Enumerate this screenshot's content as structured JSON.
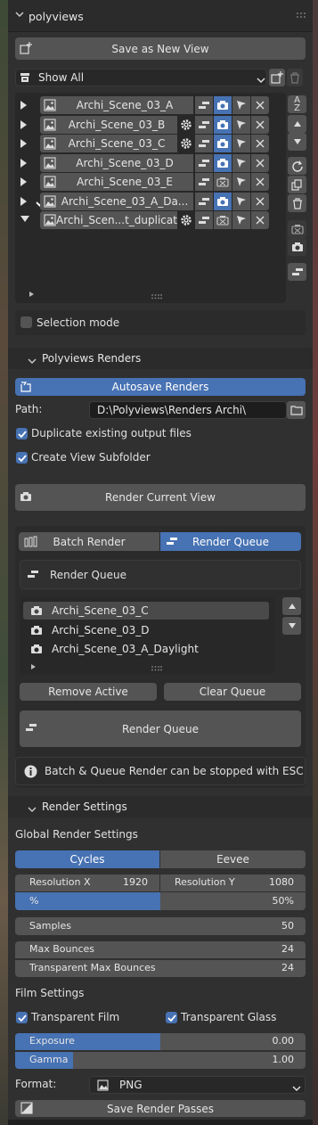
{
  "panel": {
    "title": "polyviews"
  },
  "save_view": {
    "label": "Save as New View"
  },
  "filter": {
    "value": "Show All"
  },
  "views": [
    {
      "name": "Archi_Scene_03_A",
      "gear": false,
      "check": false,
      "expanded": false,
      "render_on": true
    },
    {
      "name": "Archi_Scene_03_B",
      "gear": true,
      "check": false,
      "expanded": false,
      "render_on": true
    },
    {
      "name": "Archi_Scene_03_C",
      "gear": true,
      "check": false,
      "expanded": false,
      "render_on": true
    },
    {
      "name": "Archi_Scene_03_D",
      "gear": false,
      "check": false,
      "expanded": false,
      "render_on": true
    },
    {
      "name": "Archi_Scene_03_E",
      "gear": false,
      "check": false,
      "expanded": false,
      "render_on": false
    },
    {
      "name": "Archi_Scene_03_A_Da...",
      "gear": false,
      "check": true,
      "expanded": false,
      "render_on": true
    },
    {
      "name": "Archi_Scen...t_duplicate",
      "gear": true,
      "check": false,
      "expanded": true,
      "render_on": false
    }
  ],
  "selection_mode": {
    "label": "Selection mode"
  },
  "renders": {
    "title": "Polyviews Renders",
    "autosave_label": "Autosave Renders",
    "path_label": "Path:",
    "path_value": "D:\\Polyviews\\Renders Archi\\",
    "duplicate_label": "Duplicate existing output files",
    "subfolder_label": "Create View Subfolder",
    "render_current_label": "Render Current View",
    "tab_batch": "Batch Render",
    "tab_queue": "Render Queue",
    "queue_header": "Render Queue",
    "queue_items": [
      "Archi_Scene_03_C",
      "Archi_Scene_03_D",
      "Archi_Scene_03_A_Daylight"
    ],
    "remove_active_label": "Remove Active",
    "clear_queue_label": "Clear Queue",
    "render_queue_button": "Render Queue",
    "info_text": "Batch & Queue Render can be stopped with ESC"
  },
  "settings": {
    "title": "Render Settings",
    "global_label": "Global Render Settings",
    "engine_cycles": "Cycles",
    "engine_eevee": "Eevee",
    "resx_label": "Resolution X",
    "resx_value": "1920",
    "resy_label": "Resolution Y",
    "resy_value": "1080",
    "percent_label": "%",
    "percent_value": "50%",
    "samples_label": "Samples",
    "samples_value": "50",
    "max_bounces_label": "Max Bounces",
    "max_bounces_value": "24",
    "transp_bounces_label": "Transparent Max Bounces",
    "transp_bounces_value": "24",
    "film_label": "Film Settings",
    "transparent_film_label": "Transparent Film",
    "transparent_glass_label": "Transparent Glass",
    "exposure_label": "Exposure",
    "exposure_value": "0.00",
    "gamma_label": "Gamma",
    "gamma_value": "1.00",
    "format_label": "Format:",
    "format_value": "PNG",
    "save_passes_label": "Save Render Passes"
  },
  "colors": {
    "accent": "#4772b3",
    "panel": "#303030",
    "widget": "#545454"
  }
}
